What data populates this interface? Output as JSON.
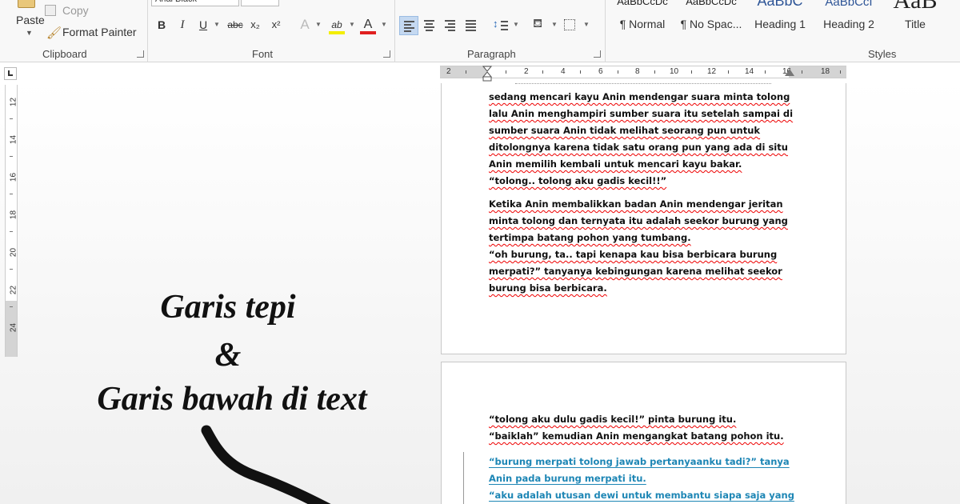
{
  "ribbon": {
    "clipboard": {
      "paste_label": "Paste",
      "copy_label": "Copy",
      "format_painter_label": "Format Painter",
      "group_label": "Clipboard"
    },
    "font": {
      "font_name": "Arial Black",
      "group_label": "Font",
      "tools": [
        "B",
        "I",
        "U",
        "abc",
        "x₂",
        "x²",
        "A",
        "ab",
        "A"
      ],
      "highlight_color": "#f3ee00",
      "font_color": "#e02020"
    },
    "paragraph": {
      "group_label": "Paragraph",
      "active_alignment": "align-left"
    },
    "styles": {
      "group_label": "Styles",
      "items": [
        {
          "sample": "AaBbCcDc",
          "name": "¶ Normal"
        },
        {
          "sample": "AaBbCcDc",
          "name": "¶ No Spac..."
        },
        {
          "sample": "AaBbC",
          "name": "Heading 1"
        },
        {
          "sample": "AaBbCcI",
          "name": "Heading 2"
        },
        {
          "sample": "AaB",
          "name": "Title"
        }
      ]
    }
  },
  "ruler": {
    "horizontal": [
      "2",
      "2",
      "4",
      "6",
      "8",
      "10",
      "12",
      "14",
      "16",
      "18"
    ],
    "vertical": [
      "12",
      "14",
      "16",
      "18",
      "20",
      "22",
      "24"
    ]
  },
  "document": {
    "page1": {
      "para1": [
        "sedang mencari kayu Anin mendengar suara minta tolong",
        "lalu Anin menghampiri sumber suara itu setelah sampai di",
        "sumber suara Anin tidak melihat seorang pun untuk",
        "ditolongnya karena tidak satu orang pun yang ada di situ",
        "Anin memilih kembali untuk mencari kayu bakar.",
        "“tolong.. tolong aku gadis kecil!!”"
      ],
      "para2": [
        "Ketika Anin membalikkan badan Anin mendengar jeritan",
        "minta tolong dan ternyata itu adalah seekor burung yang",
        "tertimpa batang pohon yang tumbang.",
        "“oh burung, ta.. tapi kenapa kau bisa berbicara burung",
        "merpati?” tanyanya kebingungan karena melihat seekor",
        "burung bisa berbicara."
      ]
    },
    "page2": {
      "para1": [
        "“tolong aku dulu gadis kecil!” pinta burung itu.",
        "“baiklah” kemudian Anin mengangkat batang pohon itu."
      ],
      "para2_blue": [
        "“burung merpati tolong jawab pertanyaanku tadi?” tanya",
        "Anin pada burung merpati itu.",
        "“aku adalah utusan dewi untuk membantu siapa saja yang"
      ]
    }
  },
  "annotation": {
    "line1": "Garis tepi",
    "line2": "&",
    "line3": "Garis bawah di text"
  }
}
